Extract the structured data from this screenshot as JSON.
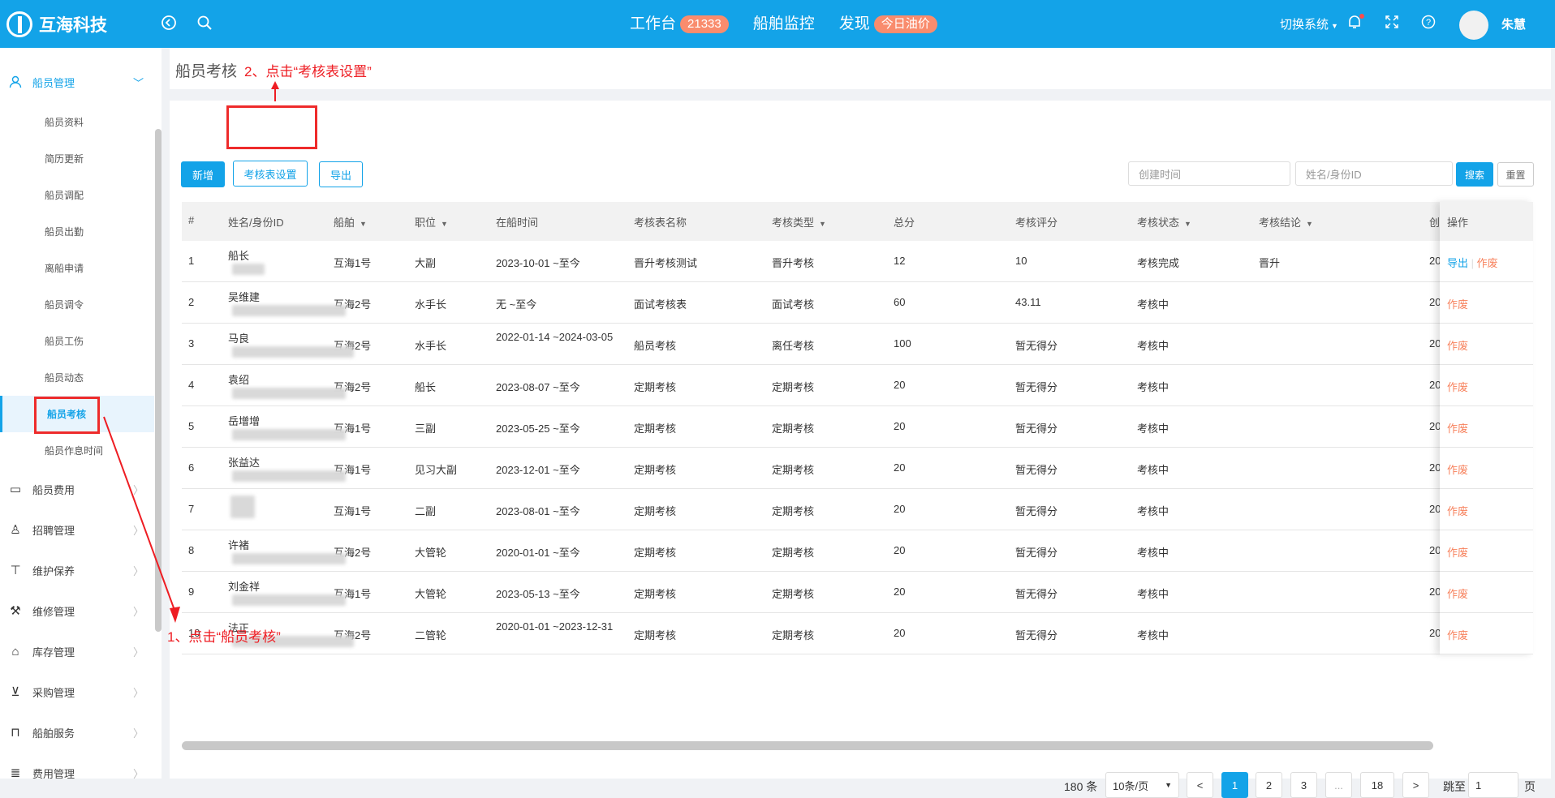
{
  "topbar": {
    "logo_text": "互海科技",
    "nav": [
      {
        "label": "工作台",
        "badge": "21333"
      },
      {
        "label": "船舶监控",
        "badge": ""
      },
      {
        "label": "发现",
        "badge": "今日油价"
      }
    ],
    "switch_system": "切换系统",
    "user_name": "朱慧"
  },
  "sidebar": {
    "crew_mgmt": "船员管理",
    "sub_items": [
      "船员资料",
      "简历更新",
      "船员调配",
      "船员出勤",
      "离船申请",
      "船员调令",
      "船员工伤",
      "船员动态",
      "船员考核",
      "船员作息时间"
    ],
    "menus": [
      "船员费用",
      "招聘管理",
      "维护保养",
      "维修管理",
      "库存管理",
      "采购管理",
      "船舶服务",
      "费用管理"
    ]
  },
  "page": {
    "title": "船员考核"
  },
  "toolbar": {
    "add": "新增",
    "settings": "考核表设置",
    "export": "导出",
    "search": "搜索",
    "reset": "重置"
  },
  "filters": {
    "created_time_placeholder": "创建时间",
    "name_id_placeholder": "姓名/身份ID"
  },
  "table": {
    "headers": {
      "no": "#",
      "name": "姓名/身份ID",
      "ship": "船舶",
      "position": "职位",
      "onboard": "在船时间",
      "form_name": "考核表名称",
      "type": "考核类型",
      "total": "总分",
      "score": "考核评分",
      "status": "考核状态",
      "conclusion": "考核结论",
      "created": "创",
      "ops": "操作"
    },
    "rows": [
      {
        "no": "1",
        "name": "船长",
        "ship": "互海1号",
        "position": "大副",
        "onboard": "2023-10-01 ~至今",
        "form": "晋升考核测试",
        "type": "晋升考核",
        "total": "12",
        "score": "10",
        "status": "考核完成",
        "conclusion": "晋升",
        "created": "20",
        "op1": "导出",
        "op2": "作废"
      },
      {
        "no": "2",
        "name": "吴维建",
        "ship": "互海2号",
        "position": "水手长",
        "onboard": "无 ~至今",
        "form": "面试考核表",
        "type": "面试考核",
        "total": "60",
        "score": "43.11",
        "status": "考核中",
        "conclusion": "",
        "created": "20",
        "op1": "",
        "op2": "作废"
      },
      {
        "no": "3",
        "name": "马良",
        "ship": "互海2号",
        "position": "水手长",
        "onboard": "2022-01-14 ~2024-03-05",
        "form": "船员考核",
        "type": "离任考核",
        "total": "100",
        "score": "暂无得分",
        "status": "考核中",
        "conclusion": "",
        "created": "20",
        "op1": "",
        "op2": "作废"
      },
      {
        "no": "4",
        "name": "袁绍",
        "ship": "互海2号",
        "position": "船长",
        "onboard": "2023-08-07 ~至今",
        "form": "定期考核",
        "type": "定期考核",
        "total": "20",
        "score": "暂无得分",
        "status": "考核中",
        "conclusion": "",
        "created": "20",
        "op1": "",
        "op2": "作废"
      },
      {
        "no": "5",
        "name": "岳增增",
        "ship": "互海1号",
        "position": "三副",
        "onboard": "2023-05-25 ~至今",
        "form": "定期考核",
        "type": "定期考核",
        "total": "20",
        "score": "暂无得分",
        "status": "考核中",
        "conclusion": "",
        "created": "20",
        "op1": "",
        "op2": "作废"
      },
      {
        "no": "6",
        "name": "张益达",
        "ship": "互海1号",
        "position": "见习大副",
        "onboard": "2023-12-01 ~至今",
        "form": "定期考核",
        "type": "定期考核",
        "total": "20",
        "score": "暂无得分",
        "status": "考核中",
        "conclusion": "",
        "created": "20",
        "op1": "",
        "op2": "作废"
      },
      {
        "no": "7",
        "name": "",
        "ship": "互海1号",
        "position": "二副",
        "onboard": "2023-08-01 ~至今",
        "form": "定期考核",
        "type": "定期考核",
        "total": "20",
        "score": "暂无得分",
        "status": "考核中",
        "conclusion": "",
        "created": "20",
        "op1": "",
        "op2": "作废"
      },
      {
        "no": "8",
        "name": "许褚",
        "ship": "互海2号",
        "position": "大管轮",
        "onboard": "2020-01-01 ~至今",
        "form": "定期考核",
        "type": "定期考核",
        "total": "20",
        "score": "暂无得分",
        "status": "考核中",
        "conclusion": "",
        "created": "20",
        "op1": "",
        "op2": "作废"
      },
      {
        "no": "9",
        "name": "刘金祥",
        "ship": "互海1号",
        "position": "大管轮",
        "onboard": "2023-05-13 ~至今",
        "form": "定期考核",
        "type": "定期考核",
        "total": "20",
        "score": "暂无得分",
        "status": "考核中",
        "conclusion": "",
        "created": "20",
        "op1": "",
        "op2": "作废"
      },
      {
        "no": "10",
        "name": "法正",
        "ship": "互海2号",
        "position": "二管轮",
        "onboard": "2020-01-01 ~2023-12-31",
        "form": "定期考核",
        "type": "定期考核",
        "total": "20",
        "score": "暂无得分",
        "status": "考核中",
        "conclusion": "",
        "created": "20",
        "op1": "",
        "op2": "作废"
      }
    ]
  },
  "pagination": {
    "total": "180 条",
    "page_size": "10条/页",
    "prev": "<",
    "pages": [
      "1",
      "2",
      "3",
      "...",
      "18"
    ],
    "next": ">",
    "jump_label": "跳至",
    "jump_value": "1",
    "page_unit": "页"
  },
  "annotations": {
    "step1": "1、点击“船员考核”",
    "step2": "2、点击“考核表设置”"
  }
}
